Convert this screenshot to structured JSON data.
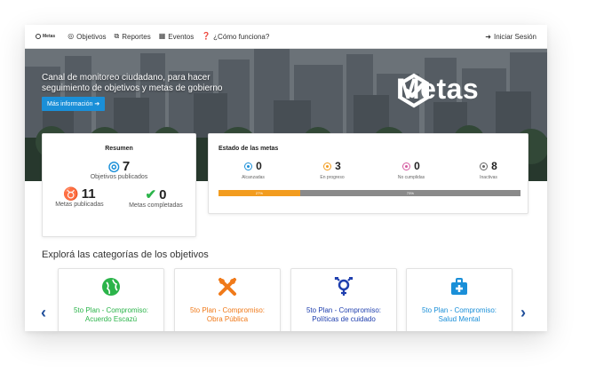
{
  "navbar": {
    "brand": "Metas",
    "items": [
      {
        "label": "Objetivos",
        "icon": "target-icon"
      },
      {
        "label": "Reportes",
        "icon": "copy-icon"
      },
      {
        "label": "Eventos",
        "icon": "calendar-icon"
      },
      {
        "label": "¿Cómo funciona?",
        "icon": "question-icon"
      }
    ],
    "login_label": "Iniciar Sesión"
  },
  "hero": {
    "tagline": "Canal de monitoreo ciudadano, para hacer seguimiento de objetivos y metas de gobierno",
    "button_label": "Más información",
    "logo_text": "Metas"
  },
  "summary": {
    "title": "Resumen",
    "objetivos_count": "7",
    "objetivos_label": "Objetivos publicados",
    "metas_count": "11",
    "metas_label": "Metas publicadas",
    "completadas_count": "0",
    "completadas_label": "Metas completadas"
  },
  "estado": {
    "title": "Estado de las metas",
    "items": [
      {
        "value": "0",
        "label": "Alcanzadas",
        "color": "#1a8fd8"
      },
      {
        "value": "3",
        "label": "En progreso",
        "color": "#f29c1f"
      },
      {
        "value": "0",
        "label": "No cumplidas",
        "color": "#d45aa0"
      },
      {
        "value": "8",
        "label": "Inactivas",
        "color": "#666666"
      }
    ],
    "bar": [
      {
        "label": "27%",
        "percent": 27,
        "color": "#f29c1f"
      },
      {
        "label": "73%",
        "percent": 73,
        "color": "#8a8a8a"
      }
    ]
  },
  "categorias": {
    "title": "Explorá las categorías de los objetivos",
    "items": [
      {
        "name": "5to Plan - Compromiso: Acuerdo Escazú",
        "color": "#2bb44a",
        "icon": "globe-icon"
      },
      {
        "name": "5to Plan - Compromiso: Obra Pública",
        "color": "#f07a1a",
        "icon": "tools-icon"
      },
      {
        "name": "5to Plan - Compromiso: Políticas de cuidado",
        "color": "#1f3fae",
        "icon": "gender-icon"
      },
      {
        "name": "5to Plan - Compromiso: Salud Mental",
        "color": "#1a8fd8",
        "icon": "medkit-icon"
      }
    ]
  }
}
